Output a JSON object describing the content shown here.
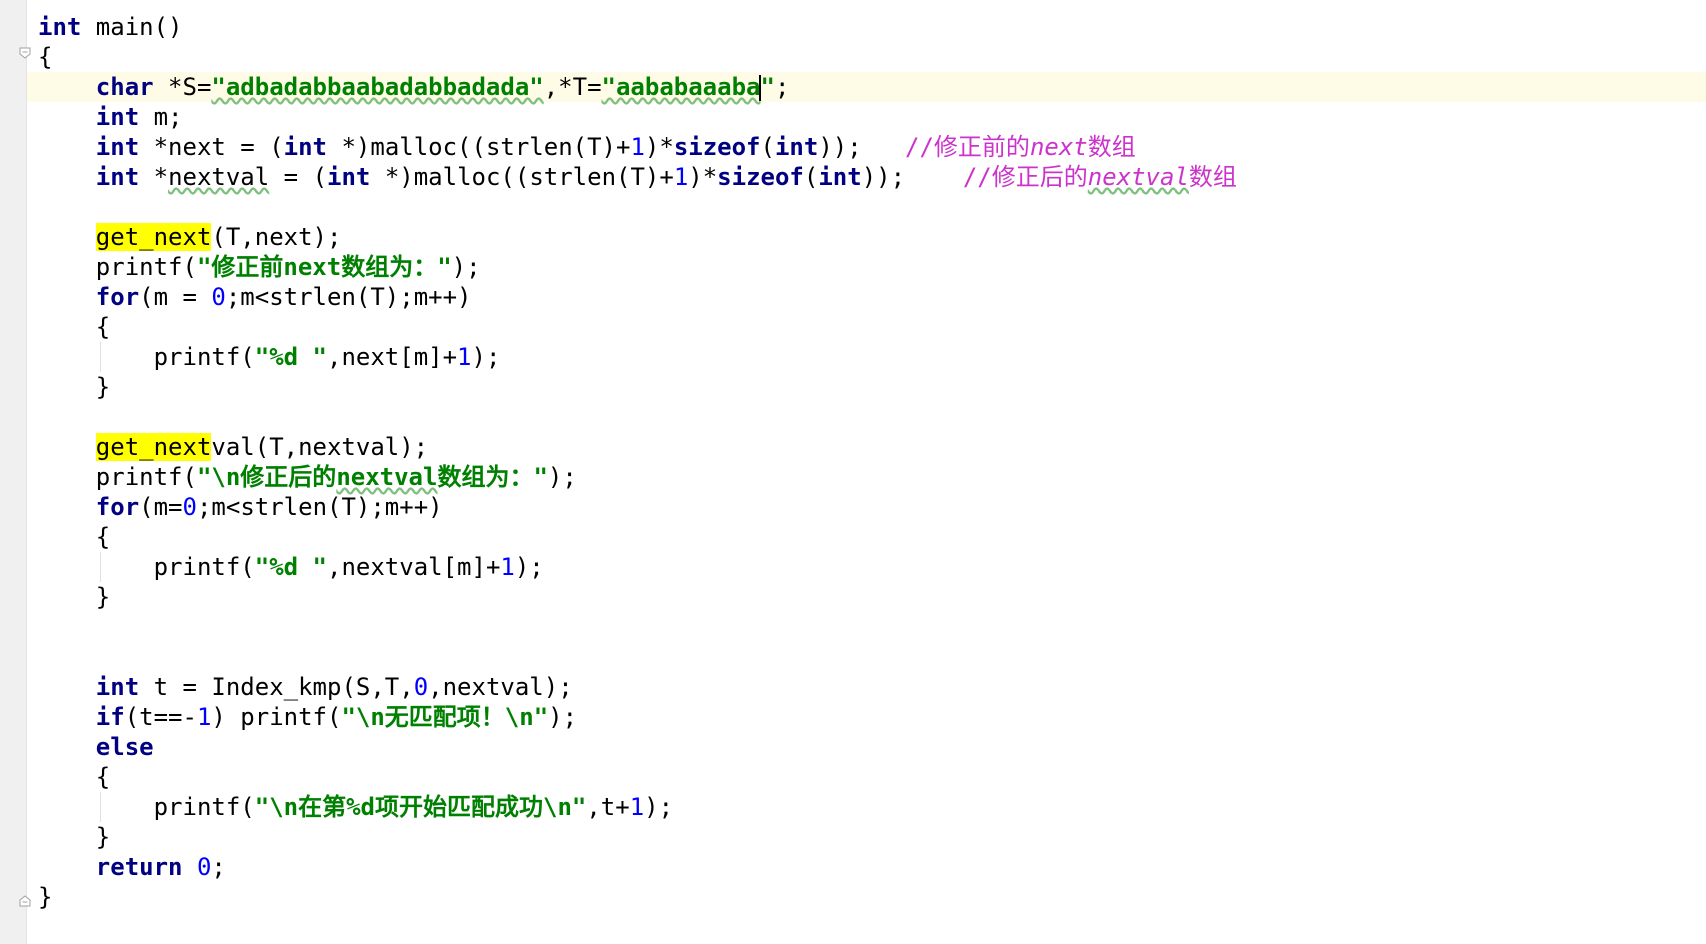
{
  "editor": {
    "language": "C",
    "lines": [
      {
        "tokens": [
          {
            "t": "kw",
            "v": "int"
          },
          {
            "t": "p",
            "v": " main()"
          }
        ]
      },
      {
        "tokens": [
          {
            "t": "p",
            "v": "{"
          }
        ]
      },
      {
        "tokens": [
          {
            "t": "p",
            "v": "    "
          },
          {
            "t": "kw",
            "v": "char"
          },
          {
            "t": "p",
            "v": " *S="
          },
          {
            "t": "str",
            "v": "\"adbadabbaabadabbadada\"",
            "wavy": true
          },
          {
            "t": "p",
            "v": ",*T="
          },
          {
            "t": "str",
            "v": "\"aababaaaba",
            "wavy": true
          },
          {
            "t": "caret",
            "v": ""
          },
          {
            "t": "str",
            "v": "\""
          },
          {
            "t": "p",
            "v": ";"
          }
        ]
      },
      {
        "tokens": [
          {
            "t": "p",
            "v": "    "
          },
          {
            "t": "kw",
            "v": "int"
          },
          {
            "t": "p",
            "v": " m;"
          }
        ]
      },
      {
        "tokens": [
          {
            "t": "p",
            "v": "    "
          },
          {
            "t": "kw",
            "v": "int"
          },
          {
            "t": "p",
            "v": " *next = ("
          },
          {
            "t": "kw",
            "v": "int"
          },
          {
            "t": "p",
            "v": " *)malloc((strlen(T)+"
          },
          {
            "t": "num",
            "v": "1"
          },
          {
            "t": "p",
            "v": ")*"
          },
          {
            "t": "kw",
            "v": "sizeof"
          },
          {
            "t": "p",
            "v": "("
          },
          {
            "t": "kw",
            "v": "int"
          },
          {
            "t": "p",
            "v": "));   "
          },
          {
            "t": "cmp",
            "v": "//修正前的"
          },
          {
            "t": "cm",
            "v": "next"
          },
          {
            "t": "cmp",
            "v": "数组"
          }
        ]
      },
      {
        "tokens": [
          {
            "t": "p",
            "v": "    "
          },
          {
            "t": "kw",
            "v": "int"
          },
          {
            "t": "p",
            "v": " *"
          },
          {
            "t": "p",
            "v": "nextval",
            "wavy": true
          },
          {
            "t": "p",
            "v": " = ("
          },
          {
            "t": "kw",
            "v": "int"
          },
          {
            "t": "p",
            "v": " *)malloc((strlen(T)+"
          },
          {
            "t": "num",
            "v": "1"
          },
          {
            "t": "p",
            "v": ")*"
          },
          {
            "t": "kw",
            "v": "sizeof"
          },
          {
            "t": "p",
            "v": "("
          },
          {
            "t": "kw",
            "v": "int"
          },
          {
            "t": "p",
            "v": "));    "
          },
          {
            "t": "cmp",
            "v": "//修正后的"
          },
          {
            "t": "cm",
            "v": "nextval",
            "wavy": true
          },
          {
            "t": "cmp",
            "v": "数组"
          }
        ]
      },
      {
        "tokens": []
      },
      {
        "tokens": [
          {
            "t": "p",
            "v": "    "
          },
          {
            "t": "hl",
            "v": "get_next"
          },
          {
            "t": "p",
            "v": "(T,next);"
          }
        ]
      },
      {
        "tokens": [
          {
            "t": "p",
            "v": "    printf("
          },
          {
            "t": "str",
            "v": "\"修正前next数组为：\""
          },
          {
            "t": "p",
            "v": ");"
          }
        ]
      },
      {
        "tokens": [
          {
            "t": "p",
            "v": "    "
          },
          {
            "t": "kw",
            "v": "for"
          },
          {
            "t": "p",
            "v": "(m = "
          },
          {
            "t": "num",
            "v": "0"
          },
          {
            "t": "p",
            "v": ";m<strlen(T);m++)"
          }
        ]
      },
      {
        "tokens": [
          {
            "t": "p",
            "v": "    {"
          }
        ]
      },
      {
        "tokens": [
          {
            "t": "p",
            "v": "        printf("
          },
          {
            "t": "str",
            "v": "\"%d \""
          },
          {
            "t": "p",
            "v": ",next[m]+"
          },
          {
            "t": "num",
            "v": "1"
          },
          {
            "t": "p",
            "v": ");"
          }
        ]
      },
      {
        "tokens": [
          {
            "t": "p",
            "v": "    }"
          }
        ]
      },
      {
        "tokens": []
      },
      {
        "tokens": [
          {
            "t": "p",
            "v": "    "
          },
          {
            "t": "hl",
            "v": "get_next"
          },
          {
            "t": "p",
            "v": "val(T,nextval);"
          }
        ]
      },
      {
        "tokens": [
          {
            "t": "p",
            "v": "    printf("
          },
          {
            "t": "str",
            "v": "\"\\n修正后的"
          },
          {
            "t": "str",
            "v": "nextval",
            "wavy": true
          },
          {
            "t": "str",
            "v": "数组为：\""
          },
          {
            "t": "p",
            "v": ");"
          }
        ]
      },
      {
        "tokens": [
          {
            "t": "p",
            "v": "    "
          },
          {
            "t": "kw",
            "v": "for"
          },
          {
            "t": "p",
            "v": "(m="
          },
          {
            "t": "num",
            "v": "0"
          },
          {
            "t": "p",
            "v": ";m<strlen(T);m++)"
          }
        ]
      },
      {
        "tokens": [
          {
            "t": "p",
            "v": "    {"
          }
        ]
      },
      {
        "tokens": [
          {
            "t": "p",
            "v": "        printf("
          },
          {
            "t": "str",
            "v": "\"%d \""
          },
          {
            "t": "p",
            "v": ",nextval[m]+"
          },
          {
            "t": "num",
            "v": "1"
          },
          {
            "t": "p",
            "v": ");"
          }
        ]
      },
      {
        "tokens": [
          {
            "t": "p",
            "v": "    }"
          }
        ]
      },
      {
        "tokens": []
      },
      {
        "tokens": []
      },
      {
        "tokens": [
          {
            "t": "p",
            "v": "    "
          },
          {
            "t": "kw",
            "v": "int"
          },
          {
            "t": "p",
            "v": " t = Index_kmp(S,T,"
          },
          {
            "t": "num",
            "v": "0"
          },
          {
            "t": "p",
            "v": ",nextval);"
          }
        ]
      },
      {
        "tokens": [
          {
            "t": "p",
            "v": "    "
          },
          {
            "t": "kw",
            "v": "if"
          },
          {
            "t": "p",
            "v": "(t==-"
          },
          {
            "t": "num",
            "v": "1"
          },
          {
            "t": "p",
            "v": ") printf("
          },
          {
            "t": "str",
            "v": "\"\\n无匹配项！\\n\""
          },
          {
            "t": "p",
            "v": ");"
          }
        ]
      },
      {
        "tokens": [
          {
            "t": "p",
            "v": "    "
          },
          {
            "t": "kw",
            "v": "else"
          }
        ]
      },
      {
        "tokens": [
          {
            "t": "p",
            "v": "    {"
          }
        ]
      },
      {
        "tokens": [
          {
            "t": "p",
            "v": "        printf("
          },
          {
            "t": "str",
            "v": "\"\\n在第%d项开始匹配成功\\n\""
          },
          {
            "t": "p",
            "v": ",t+"
          },
          {
            "t": "num",
            "v": "1"
          },
          {
            "t": "p",
            "v": ");"
          }
        ]
      },
      {
        "tokens": [
          {
            "t": "p",
            "v": "    }"
          }
        ]
      },
      {
        "tokens": [
          {
            "t": "p",
            "v": "    "
          },
          {
            "t": "kw",
            "v": "return"
          },
          {
            "t": "p",
            "v": " "
          },
          {
            "t": "num",
            "v": "0"
          },
          {
            "t": "p",
            "v": ";"
          }
        ]
      },
      {
        "tokens": [
          {
            "t": "p",
            "v": "}"
          }
        ]
      }
    ]
  },
  "colors": {
    "keyword": "#000080",
    "string": "#008000",
    "number": "#0000ff",
    "comment": "#cc33cc",
    "highlight": "#ffff00",
    "current_line": "#fefbe6",
    "gutter": "#f0f0f0"
  },
  "icons": [
    "fold-open-icon",
    "fold-close-icon"
  ]
}
